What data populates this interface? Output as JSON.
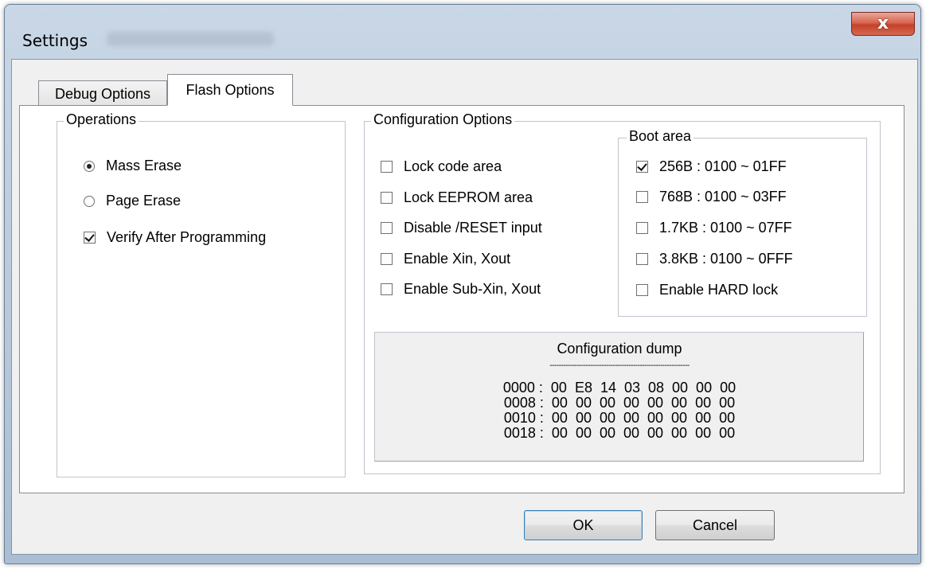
{
  "window": {
    "title": "Settings",
    "close_label": "x"
  },
  "tabs": [
    {
      "label": "Debug Options",
      "active": false
    },
    {
      "label": "Flash Options",
      "active": true
    }
  ],
  "operations": {
    "title": "Operations",
    "mass_erase": {
      "label": "Mass Erase",
      "selected": true
    },
    "page_erase": {
      "label": "Page Erase",
      "selected": false
    },
    "verify": {
      "label": "Verify After Programming",
      "checked": true
    }
  },
  "config": {
    "title": "Configuration Options",
    "options": [
      {
        "label": "Lock code area",
        "checked": false
      },
      {
        "label": "Lock EEPROM area",
        "checked": false
      },
      {
        "label": "Disable /RESET input",
        "checked": false
      },
      {
        "label": "Enable Xin, Xout",
        "checked": false
      },
      {
        "label": "Enable Sub-Xin, Xout",
        "checked": false
      }
    ]
  },
  "boot_area": {
    "title": "Boot area",
    "options": [
      {
        "label": "256B : 0100 ~ 01FF",
        "checked": true
      },
      {
        "label": "768B : 0100 ~ 03FF",
        "checked": false
      },
      {
        "label": "1.7KB : 0100 ~ 07FF",
        "checked": false
      },
      {
        "label": "3.8KB : 0100 ~ 0FFF",
        "checked": false
      },
      {
        "label": "Enable HARD lock",
        "checked": false
      }
    ]
  },
  "dump": {
    "title": "Configuration dump",
    "separator": "--------------------------------------------------------------",
    "lines": [
      "0000 :  00  E8  14  03  08  00  00  00",
      "0008 :  00  00  00  00  00  00  00  00",
      "0010 :  00  00  00  00  00  00  00  00",
      "0018 :  00  00  00  00  00  00  00  00"
    ]
  },
  "buttons": {
    "ok": "OK",
    "cancel": "Cancel"
  }
}
